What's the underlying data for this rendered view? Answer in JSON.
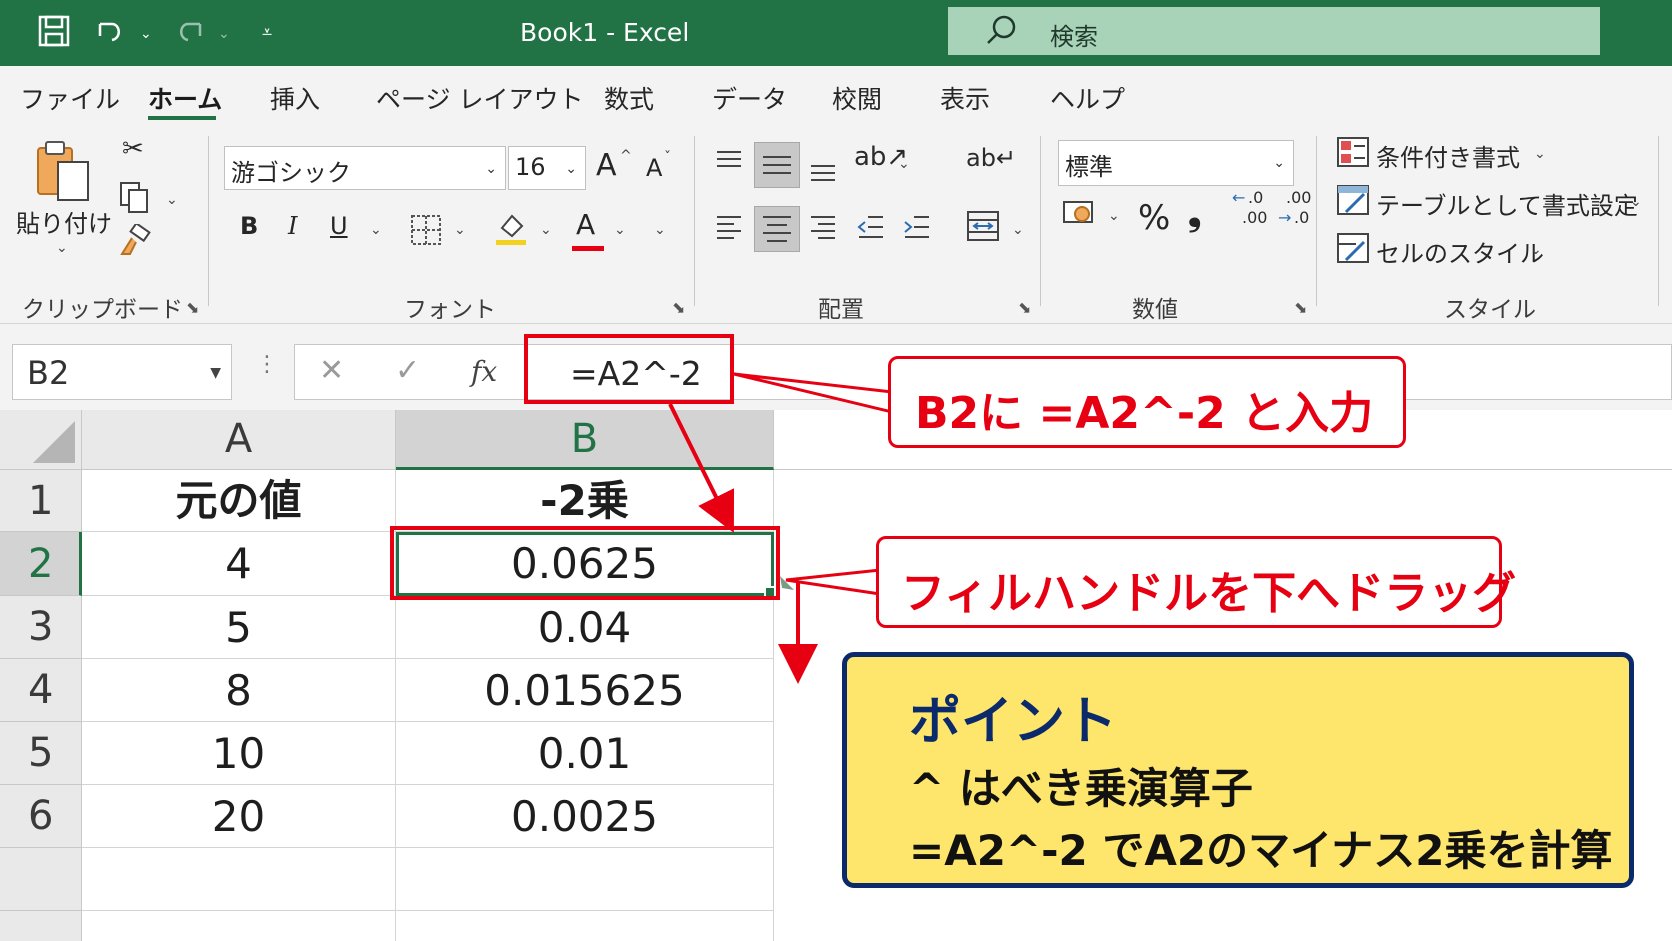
{
  "titlebar": {
    "title": "Book1  -  Excel",
    "search_text": "検索",
    "accent_color": "#217346",
    "icons": [
      "save-icon",
      "undo-icon",
      "redo-icon",
      "customize-quick-access-icon",
      "search-icon"
    ]
  },
  "tabs": [
    {
      "label": "ファイル",
      "active": false
    },
    {
      "label": "ホーム",
      "active": true
    },
    {
      "label": "挿入",
      "active": false
    },
    {
      "label": "ページ レイアウト",
      "active": false
    },
    {
      "label": "数式",
      "active": false
    },
    {
      "label": "データ",
      "active": false
    },
    {
      "label": "校閲",
      "active": false
    },
    {
      "label": "表示",
      "active": false
    },
    {
      "label": "ヘルプ",
      "active": false
    }
  ],
  "ribbon": {
    "clipboard": {
      "paste_label": "貼り付け",
      "group_label": "クリップボード"
    },
    "font": {
      "font_name": "游ゴシック",
      "font_size": "16",
      "grow": "A",
      "shrink": "A",
      "bold": "B",
      "italic": "I",
      "underline": "U",
      "font_color_letter": "A",
      "group_label": "フォント"
    },
    "alignment": {
      "group_label": "配置"
    },
    "number": {
      "format": "標準",
      "percent": "%",
      "comma": "❟",
      "group_label": "数値",
      "inc_decimal_top": ".0",
      "inc_decimal_bottom": ".00",
      "dec_decimal_top": ".00",
      "dec_decimal_bottom": ".0"
    },
    "styles": {
      "conditional": "条件付き書式",
      "table": "テーブルとして書式設定",
      "cell_styles": "セルのスタイル",
      "group_label": "スタイル"
    }
  },
  "formula_bar": {
    "name_box": "B2",
    "cancel": "✕",
    "enter": "✓",
    "fx": "fx",
    "formula": "=A2^-2"
  },
  "sheet": {
    "columns": [
      "A",
      "B"
    ],
    "row_numbers": [
      "1",
      "2",
      "3",
      "4",
      "5",
      "6"
    ],
    "header": [
      "元の値",
      "-2乗"
    ],
    "rows": [
      [
        "4",
        "0.0625"
      ],
      [
        "5",
        "0.04"
      ],
      [
        "8",
        "0.015625"
      ],
      [
        "10",
        "0.01"
      ],
      [
        "20",
        "0.0025"
      ]
    ],
    "active_cell": "B2"
  },
  "annotations": {
    "callout_formula": "B2に  =A2^-2  と入力",
    "callout_fill": "フィルハンドルを下へドラッグ",
    "point_title": "ポイント",
    "point_line1": "^  はべき乗演算子",
    "point_line2": "=A2^-2  でA2のマイナス2乗を計算",
    "callout_color": "#e60012",
    "point_bg": "#fde66b",
    "point_border": "#0b2a6b"
  }
}
